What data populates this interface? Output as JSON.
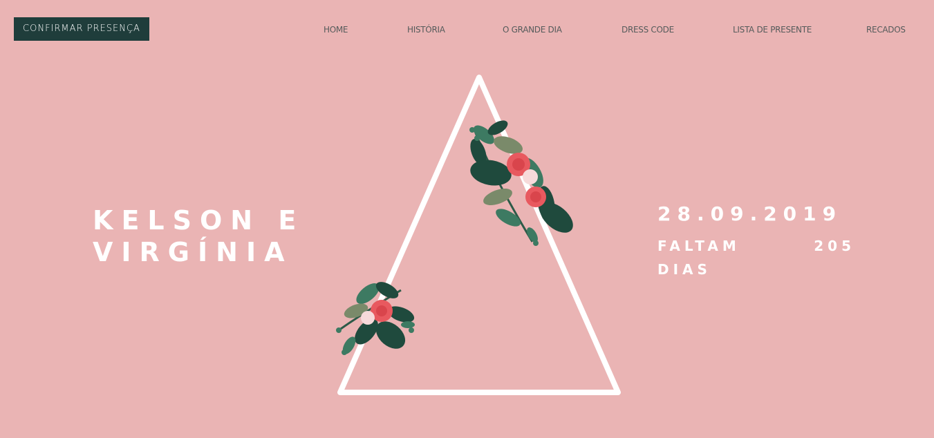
{
  "header": {
    "rsvp_label": "CONFIRMAR PRESENÇA",
    "nav": [
      {
        "label": "HOME"
      },
      {
        "label": "HISTÓRIA"
      },
      {
        "label": "O GRANDE DIA"
      },
      {
        "label": "DRESS CODE"
      },
      {
        "label": "LISTA DE PRESENTE"
      },
      {
        "label": "RECADOS"
      }
    ]
  },
  "hero": {
    "name_line1": "KELSON E",
    "name_line2": "VIRGÍNIA",
    "date": "28.09.2019",
    "countdown_word1": "FALTAM",
    "countdown_number": "205",
    "countdown_word2": "DIAS"
  },
  "colors": {
    "background": "#eab4b4",
    "button_bg": "#1f3d3b",
    "text_light": "#ffffff",
    "nav_text": "#555b5b",
    "flower_red": "#e8595f",
    "flower_white": "#f7dada",
    "leaf_dark": "#1f4a3d",
    "leaf_mid": "#3d7a62",
    "leaf_olive": "#7a8a6a"
  },
  "icons": {
    "frame": "triangle-frame",
    "decoration": "floral-bouquet"
  }
}
